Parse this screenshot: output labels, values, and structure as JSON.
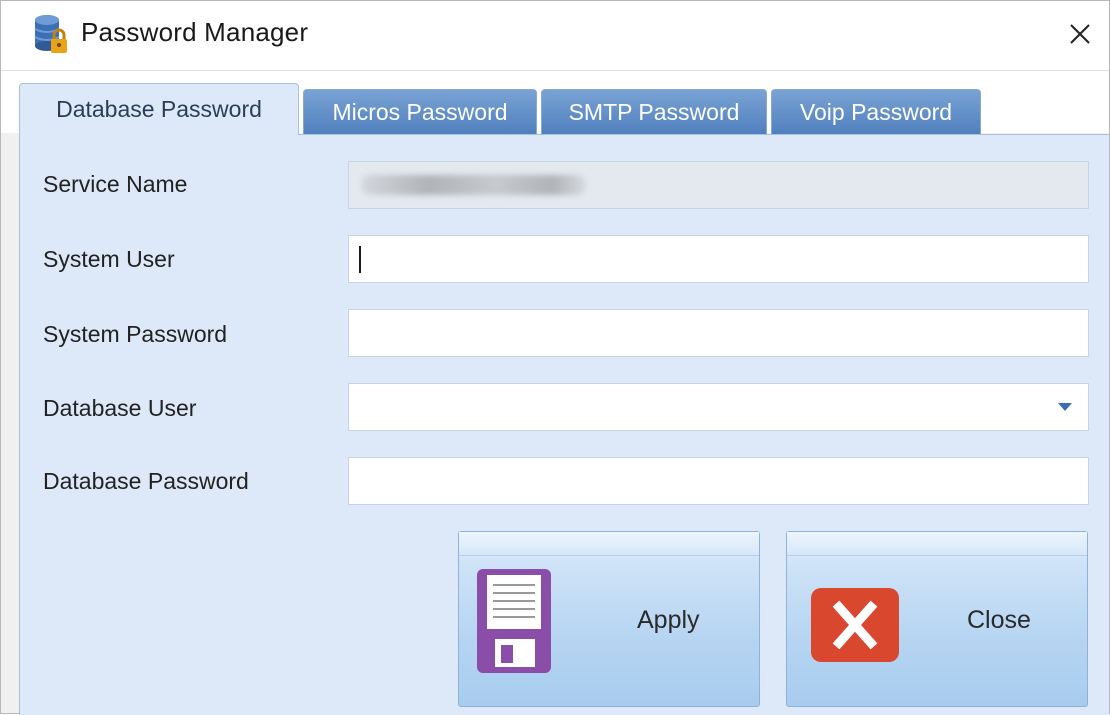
{
  "window": {
    "title": "Password Manager",
    "icon": "database-lock-icon",
    "close_icon": "close-icon"
  },
  "tabs": [
    {
      "label": "Database Password",
      "active": true
    },
    {
      "label": "Micros Password",
      "active": false
    },
    {
      "label": "SMTP Password",
      "active": false
    },
    {
      "label": "Voip Password",
      "active": false
    }
  ],
  "form": {
    "service_name": {
      "label": "Service Name",
      "value": "",
      "disabled": true
    },
    "system_user": {
      "label": "System User",
      "value": ""
    },
    "system_password": {
      "label": "System Password",
      "value": ""
    },
    "database_user": {
      "label": "Database User",
      "value": ""
    },
    "database_password": {
      "label": "Database Password",
      "value": ""
    }
  },
  "buttons": {
    "apply": {
      "label": "Apply",
      "icon": "floppy-disk-icon"
    },
    "close": {
      "label": "Close",
      "icon": "x-mark-icon"
    }
  },
  "colors": {
    "panel_bg": "#dde9f8",
    "tab_inactive": "#4f7fbd",
    "close_icon_red": "#d9482e",
    "floppy_purple": "#8a4ea8"
  }
}
